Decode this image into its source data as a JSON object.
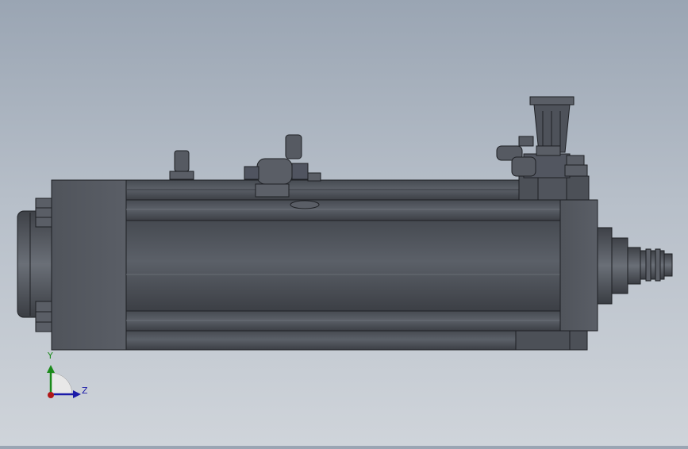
{
  "triad": {
    "y_label": "Y",
    "z_label": "Z",
    "y_color": "#1a8a1a",
    "z_color": "#1a1aa8",
    "x_color": "#b01818"
  },
  "model": {
    "body_color": "#4f535b",
    "edge_color": "#1e2024"
  }
}
